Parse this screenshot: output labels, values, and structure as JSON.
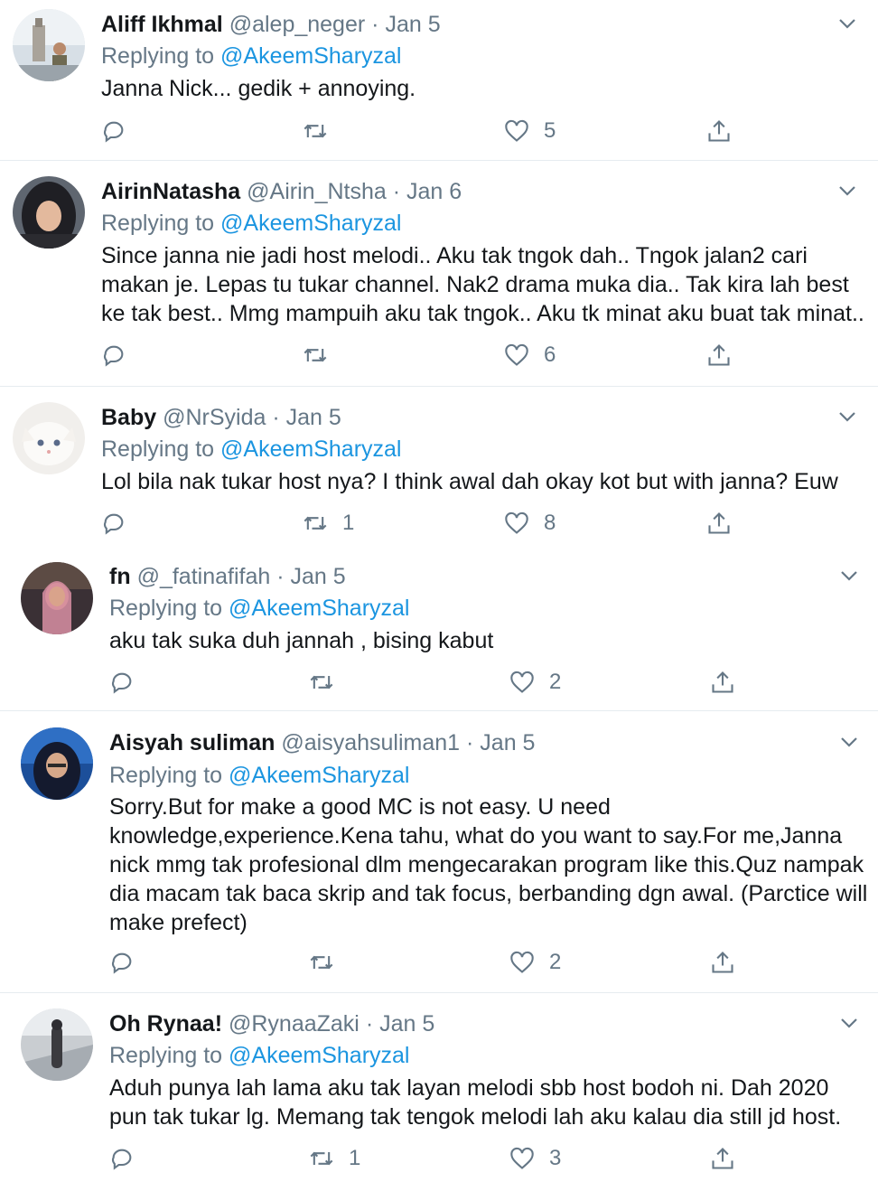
{
  "reply_prefix": "Replying to ",
  "tweets": [
    {
      "name": "Aliff Ikhmal",
      "handle": "@alep_neger",
      "date": "Jan 5",
      "reply_to": "@AkeemSharyzal",
      "text": "Janna Nick... gedik + annoying.",
      "replies": "",
      "retweets": "",
      "likes": "5"
    },
    {
      "name": "AirinNatasha",
      "handle": "@Airin_Ntsha",
      "date": "Jan 6",
      "reply_to": "@AkeemSharyzal",
      "text": "Since janna nie jadi host melodi..  Aku tak tngok dah..  Tngok jalan2 cari makan je. Lepas tu tukar channel. Nak2 drama muka dia.. Tak kira lah best ke tak best.. Mmg mampuih aku tak tngok..  Aku tk minat aku buat tak minat..",
      "replies": "",
      "retweets": "",
      "likes": "6"
    },
    {
      "name": "Baby",
      "handle": "@NrSyida",
      "date": "Jan 5",
      "reply_to": "@AkeemSharyzal",
      "text": "Lol bila nak tukar host nya? I think awal dah okay kot but with janna? Euw",
      "replies": "",
      "retweets": "1",
      "likes": "8"
    },
    {
      "name": "fn",
      "handle": "@_fatinafifah",
      "date": "Jan 5",
      "reply_to": "@AkeemSharyzal",
      "text": "aku tak suka duh jannah , bising kabut",
      "replies": "",
      "retweets": "",
      "likes": "2"
    },
    {
      "name": "Aisyah suliman",
      "handle": "@aisyahsuliman1",
      "date": "Jan 5",
      "reply_to": "@AkeemSharyzal",
      "text": "Sorry.But for make a good MC is not easy. U need knowledge,experience.Kena tahu, what do you want to say.For me,Janna nick mmg tak profesional dlm mengecarakan program like this.Quz nampak dia macam tak baca skrip and tak focus, berbanding dgn awal. (Parctice will make prefect)",
      "replies": "",
      "retweets": "",
      "likes": "2"
    },
    {
      "name": "Oh Rynaa!",
      "handle": "@RynaaZaki",
      "date": "Jan 5",
      "reply_to": "@AkeemSharyzal",
      "text": "Aduh punya lah lama aku tak layan melodi sbb host bodoh ni. Dah 2020 pun tak tukar lg. Memang tak tengok melodi lah aku kalau dia still jd host.",
      "replies": "",
      "retweets": "1",
      "likes": "3"
    }
  ],
  "colors": {
    "link": "#1b95e0",
    "muted": "#657786",
    "text": "#14171a",
    "divider": "#e6ecf0"
  },
  "icons": {
    "reply": "reply-icon",
    "retweet": "retweet-icon",
    "like": "heart-icon",
    "share": "share-icon",
    "more": "chevron-down-icon"
  }
}
